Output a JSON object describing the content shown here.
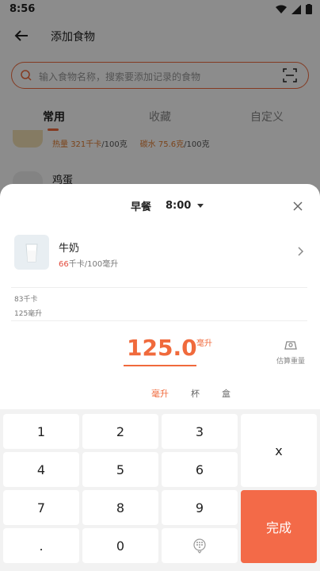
{
  "status_bar": {
    "time": "8:56"
  },
  "header": {
    "title": "添加食物"
  },
  "search": {
    "placeholder": "输入食物名称，搜索要添加记录的食物"
  },
  "tabs": [
    {
      "label": "常用"
    },
    {
      "label": "收藏"
    },
    {
      "label": "自定义"
    }
  ],
  "food_list": [
    {
      "calories_label": "热量",
      "calories_value": "321千卡",
      "calories_unit": "/100克",
      "carb_label": "碳水",
      "carb_value": "75.6克",
      "carb_unit": "/100克"
    },
    {
      "name": "鸡蛋"
    }
  ],
  "sheet": {
    "meal": "早餐",
    "time": "8:00",
    "food": {
      "name": "牛奶",
      "kcal_num": "66",
      "kcal_unit": "千卡/100毫升"
    },
    "summary_kcal": "83千卡",
    "summary_amount": "125毫升",
    "amount": "125.0",
    "amount_unit": "毫升",
    "estimate_label": "估算重量",
    "units": [
      {
        "label": "毫升"
      },
      {
        "label": "杯"
      },
      {
        "label": "盒"
      }
    ]
  },
  "keypad": {
    "keys": [
      "1",
      "2",
      "3",
      "4",
      "5",
      "6",
      "7",
      "8",
      "9",
      ".",
      "0"
    ],
    "delete_label": "x",
    "done_label": "完成"
  },
  "colors": {
    "accent": "#f06a3c",
    "done": "#f36a48",
    "red": "#e24a3b"
  }
}
